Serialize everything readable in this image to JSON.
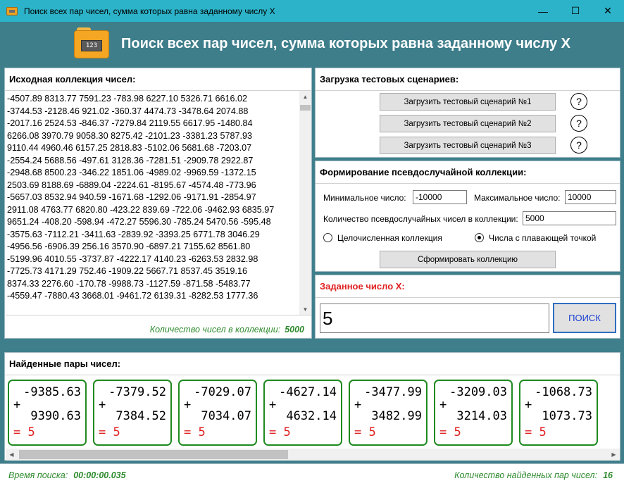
{
  "window": {
    "title": "Поиск всех пар чисел, сумма которых равна заданному числу X",
    "minimize": "—",
    "maximize": "☐",
    "close": "✕"
  },
  "header": {
    "title": "Поиск всех пар чисел, сумма которых равна заданному числу X",
    "logo_text": "123"
  },
  "source": {
    "title": "Исходная коллекция чисел:",
    "lines": [
      "-4507.89 8313.77 7591.23 -783.98 6227.10 5326.71 6616.02",
      "-3744.53 -2128.46 921.02 -360.37 4474.73 -3478.64 2074.88",
      "-2017.16 2524.53 -846.37 -7279.84 2119.55 6617.95 -1480.84",
      "6266.08 3970.79 9058.30 8275.42 -2101.23 -3381.23 5787.93",
      "9110.44 4960.46 6157.25 2818.83 -5102.06 5681.68 -7203.07",
      "-2554.24 5688.56 -497.61 3128.36 -7281.51 -2909.78 2922.87",
      "-2948.68 8500.23 -346.22 1851.06 -4989.02 -9969.59 -1372.15",
      "2503.69 8188.69 -6889.04 -2224.61 -8195.67 -4574.48 -773.96",
      "-5657.03 8532.94 940.59 -1671.68 -1292.06 -9171.91 -2854.97",
      "2911.08 4763.77 6820.80 -423.22 839.69 -722.06 -9462.93 6835.97",
      "9651.24 -408.20 -598.94 -472.27 5596.30 -785.24 5470.56 -595.48",
      "-3575.63 -7112.21 -3411.63 -2839.92 -3393.25 6771.78 3046.29",
      "-4956.56 -6906.39 256.16 3570.90 -6897.21 7155.62 8561.80",
      "-5199.96 4010.55 -3737.87 -4222.17 4140.23 -6263.53 2832.98",
      "-7725.73 4171.29 752.46 -1909.22 5667.71 8537.45 3519.16",
      "8374.33 2276.60 -170.78 -9988.73 -1127.59 -871.58 -5483.77",
      "-4559.47 -7880.43 3668.01 -9461.72 6139.31 -8282.53 1777.36"
    ],
    "count_label": "Количество чисел в коллекции:",
    "count_value": "5000",
    "scroll_position": 0.0
  },
  "scenarios": {
    "title": "Загрузка тестовых сценариев:",
    "buttons": [
      {
        "label": "Загрузить тестовый сценарий №1",
        "help": "?"
      },
      {
        "label": "Загрузить тестовый сценарий №2",
        "help": "?"
      },
      {
        "label": "Загрузить тестовый сценарий №3",
        "help": "?"
      }
    ]
  },
  "random": {
    "title": "Формирование псевдослучайной коллекции:",
    "min_label": "Минимальное число:",
    "min_value": "-10000",
    "max_label": "Максимальное число:",
    "max_value": "10000",
    "count_label": "Количество псевдослучайных чисел в коллекции:",
    "count_value": "5000",
    "radio_int": "Целочисленная коллекция",
    "radio_float": "Числа с плавающей точкой",
    "selected": "float",
    "generate_button": "Сформировать коллекцию"
  },
  "target": {
    "title": "Заданное число X:",
    "value": "5",
    "search_button": "ПОИСК"
  },
  "pairs": {
    "title": "Найденные пары чисел:",
    "items": [
      {
        "a": "-9385.63",
        "b": "9390.63",
        "sum": "= 5"
      },
      {
        "a": "-7379.52",
        "b": "7384.52",
        "sum": "= 5"
      },
      {
        "a": "-7029.07",
        "b": "7034.07",
        "sum": "= 5"
      },
      {
        "a": "-4627.14",
        "b": "4632.14",
        "sum": "= 5"
      },
      {
        "a": "-3477.99",
        "b": "3482.99",
        "sum": "= 5"
      },
      {
        "a": "-3209.03",
        "b": "3214.03",
        "sum": "= 5"
      },
      {
        "a": "-1068.73",
        "b": "1073.73",
        "sum": "= 5"
      }
    ],
    "plus": "+",
    "scroll_left": "◀",
    "scroll_right": "▶"
  },
  "status": {
    "time_label": "Время поиска:",
    "time_value": "00:00:00.035",
    "pairs_label": "Количество найденных пар чисел:",
    "pairs_value": "16"
  },
  "colors": {
    "titlebar": "#2cb3c9",
    "background": "#3f7f8c",
    "green": "#2d8a2d",
    "red": "#e02020",
    "search_border": "#2f6fc0"
  }
}
